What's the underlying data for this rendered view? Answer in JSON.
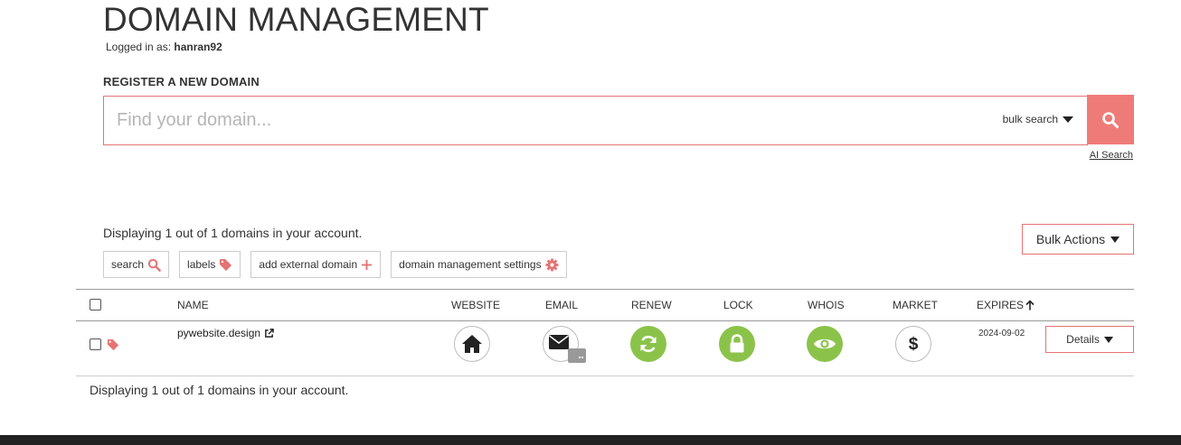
{
  "header": {
    "title": "DOMAIN MANAGEMENT",
    "logged_in_label": "Logged in as:",
    "username": "hanran92"
  },
  "register": {
    "heading": "REGISTER A NEW DOMAIN",
    "search_placeholder": "Find your domain...",
    "bulk_search_label": "bulk search",
    "ai_search_label": "AI Search",
    "accent_color": "#ef7b78"
  },
  "toolbar": {
    "display_count": "Displaying 1 out of 1 domains in your account.",
    "bulk_actions_label": "Bulk Actions",
    "buttons": [
      {
        "label": "search",
        "icon": "search-icon"
      },
      {
        "label": "labels",
        "icon": "tag-icon"
      },
      {
        "label": "add external domain",
        "icon": "plus-icon"
      },
      {
        "label": "domain management settings",
        "icon": "gear-icon"
      }
    ]
  },
  "table": {
    "columns": [
      "NAME",
      "WEBSITE",
      "EMAIL",
      "RENEW",
      "LOCK",
      "WHOIS",
      "MARKET",
      "EXPIRES"
    ],
    "rows": [
      {
        "domain": "pywebsite.design",
        "expires": "2024-09-02",
        "details_label": "Details",
        "renew_status_color": "#8bc34a",
        "lock_status_color": "#8bc34a",
        "whois_status_color": "#8bc34a"
      }
    ]
  },
  "footer": {
    "display_count": "Displaying 1 out of 1 domains in your account."
  }
}
